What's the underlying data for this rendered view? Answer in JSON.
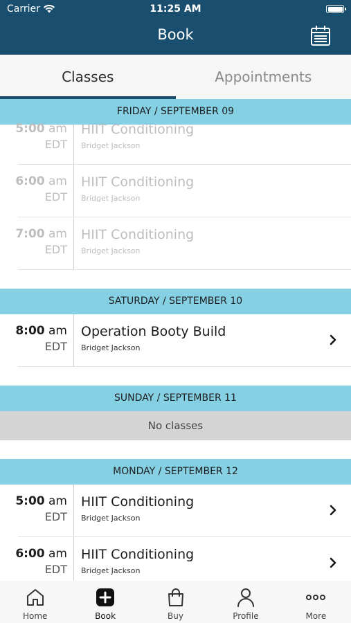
{
  "status_bar": {
    "carrier": "Carrier",
    "time": "11:25 AM"
  },
  "nav": {
    "title": "Book"
  },
  "tabs": [
    {
      "label": "Classes",
      "active": true
    },
    {
      "label": "Appointments",
      "active": false
    }
  ],
  "days": [
    {
      "header": "FRIDAY / SEPTEMBER 09",
      "classes": [
        {
          "time": "5:00",
          "ampm": "am",
          "tz": "EDT",
          "name": "HIIT Conditioning",
          "instructor": "Bridget Jackson"
        },
        {
          "time": "6:00",
          "ampm": "am",
          "tz": "EDT",
          "name": "HIIT Conditioning",
          "instructor": "Bridget Jackson"
        },
        {
          "time": "7:00",
          "ampm": "am",
          "tz": "EDT",
          "name": "HIIT Conditioning",
          "instructor": "Bridget Jackson"
        }
      ]
    },
    {
      "header": "SATURDAY / SEPTEMBER 10",
      "classes": [
        {
          "time": "8:00",
          "ampm": "am",
          "tz": "EDT",
          "name": "Operation Booty Build",
          "instructor": "Bridget Jackson"
        }
      ]
    },
    {
      "header": "SUNDAY / SEPTEMBER 11",
      "empty_text": "No classes"
    },
    {
      "header": "MONDAY / SEPTEMBER 12",
      "classes": [
        {
          "time": "5:00",
          "ampm": "am",
          "tz": "EDT",
          "name": "HIIT Conditioning",
          "instructor": "Bridget Jackson"
        },
        {
          "time": "6:00",
          "ampm": "am",
          "tz": "EDT",
          "name": "HIIT Conditioning",
          "instructor": "Bridget Jackson"
        }
      ]
    }
  ],
  "tabbar": [
    {
      "label": "Home",
      "icon": "home-icon"
    },
    {
      "label": "Book",
      "icon": "plus-square-icon"
    },
    {
      "label": "Buy",
      "icon": "shopping-bag-icon"
    },
    {
      "label": "Profile",
      "icon": "person-icon"
    },
    {
      "label": "More",
      "icon": "more-icon"
    }
  ],
  "colors": {
    "header_bg": "#1a4e6e",
    "day_header_bg": "#86d0e4",
    "no_classes_bg": "#d4d4d4",
    "past_text": "#bdbdbd"
  }
}
